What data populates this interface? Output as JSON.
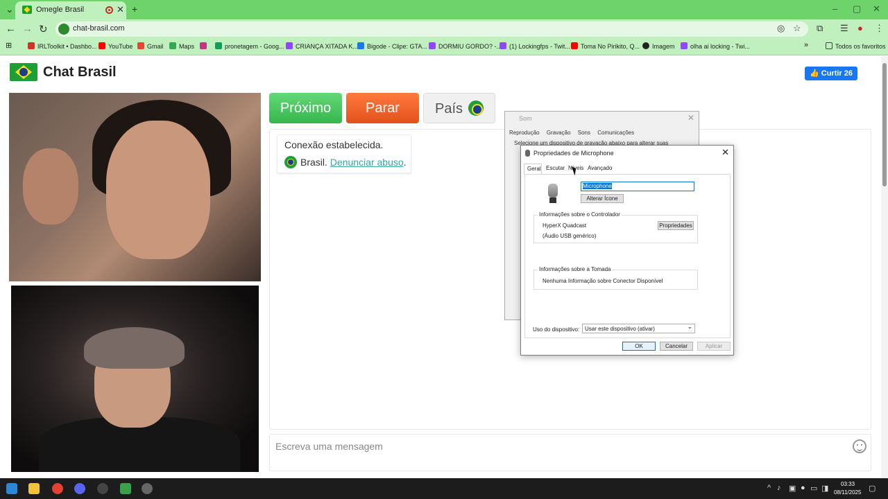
{
  "browser": {
    "tab_title": "Omegle Brasil",
    "tab_close": "✕",
    "new_tab": "+",
    "url": "chat-brasil.com",
    "window_controls": {
      "minimize": "–",
      "maximize": "▢",
      "close": "✕"
    }
  },
  "bookmarks": [
    {
      "label": "IRLToolkit • Dashbo...",
      "color": "#d93025"
    },
    {
      "label": "YouTube",
      "color": "#ff0000"
    },
    {
      "label": "Gmail",
      "color": "#ea4335"
    },
    {
      "label": "Maps",
      "color": "#34a853"
    },
    {
      "label": "",
      "color": "#c13584"
    },
    {
      "label": "pronetagem - Goog...",
      "color": "#0f9d58"
    },
    {
      "label": "CRIANÇA XITADA K...",
      "color": "#9146ff"
    },
    {
      "label": "Bigode - Clipe: GTA...",
      "color": "#1877f2"
    },
    {
      "label": "DORMIU GORDO? -...",
      "color": "#9146ff"
    },
    {
      "label": "(1) Lockingfps - Twit...",
      "color": "#9146ff"
    },
    {
      "label": "Toma No Pirikito, Q...",
      "color": "#ff0000"
    },
    {
      "label": "Imagem",
      "color": "#222222"
    },
    {
      "label": "olha ai locking - Twi...",
      "color": "#9146ff"
    }
  ],
  "bookmarks_more": "»",
  "bookmarks_all": "Todos os favoritos",
  "page": {
    "title": "Chat Brasil",
    "like_button": "Curtir 26 mil",
    "buttons": {
      "next": "Próximo",
      "stop": "Parar",
      "country": "País"
    },
    "chat": {
      "status": "Conexão estabelecida.",
      "country": "Brasil.",
      "report_link": "Denunciar abuso",
      "period": "."
    },
    "message_placeholder": "Escreva uma mensagem"
  },
  "sound_dialog": {
    "title": "Som",
    "tabs": [
      "Reprodução",
      "Gravação",
      "Sons",
      "Comunicações"
    ],
    "description": "Selecione um dispositivo de gravação abaixo para alterar suas"
  },
  "mic_dialog": {
    "title": "Propriedades de Microphone",
    "tabs": [
      "Geral",
      "Escutar",
      "Níveis",
      "Avançado"
    ],
    "name_value": "Microphone",
    "change_icon": "Alterar Ícone",
    "controller_group": "Informações sobre o Controlador",
    "controller_name": "HyperX Quadcast",
    "controller_type": "(Áudio USB genérico)",
    "properties_button": "Propriedades",
    "jack_group": "Informações sobre a Tomada",
    "jack_info": "Nenhuma Informação sobre Conector Disponível",
    "usage_label": "Uso do dispositivo:",
    "usage_value": "Usar este dispositivo (ativar)",
    "ok": "OK",
    "cancel": "Cancelar",
    "apply": "Aplicar"
  },
  "taskbar": {
    "time": "03:33",
    "date": "08/11/2025"
  }
}
